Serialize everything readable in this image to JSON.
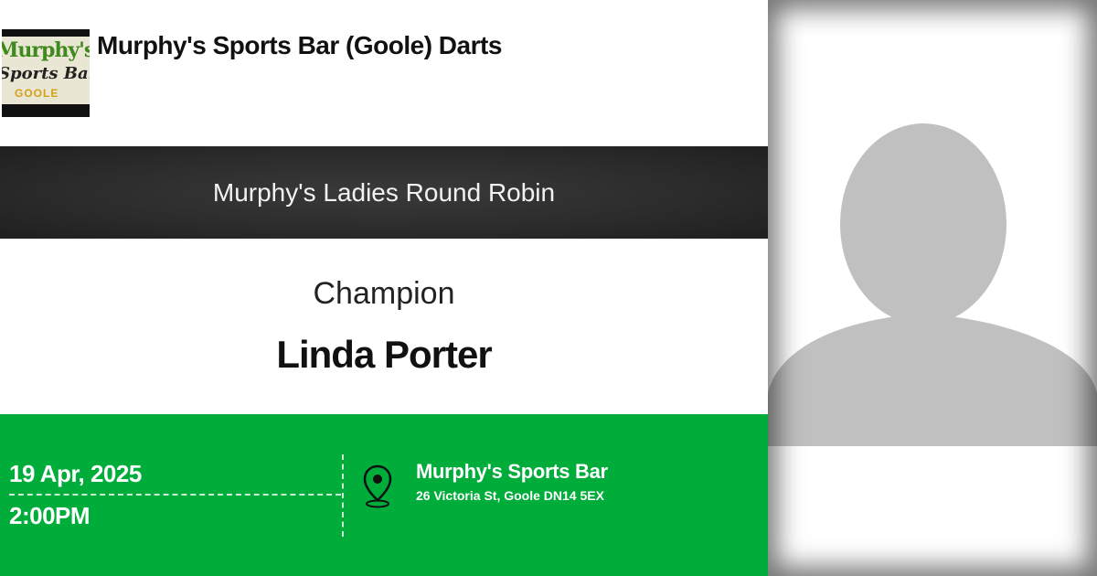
{
  "header": {
    "club_name": "Murphy's Sports Bar (Goole) Darts",
    "logo_text": [
      "Murphy's",
      "Sports Bar",
      "GOOLE"
    ]
  },
  "event": {
    "title": "Murphy's Ladies Round Robin"
  },
  "result": {
    "label": "Champion",
    "name": "Linda Porter"
  },
  "details": {
    "date": "19 Apr, 2025",
    "time": "2:00PM",
    "venue_name": "Murphy's Sports Bar",
    "venue_address": "26 Victoria St, Goole DN14 5EX",
    "location_icon": "map-pin-icon"
  },
  "colors": {
    "footer_green": "#00ac3a",
    "band_dark": "#2b2b2b",
    "avatar_gray": "#c0c0c0"
  },
  "avatar": {
    "icon": "person-silhouette-icon"
  }
}
